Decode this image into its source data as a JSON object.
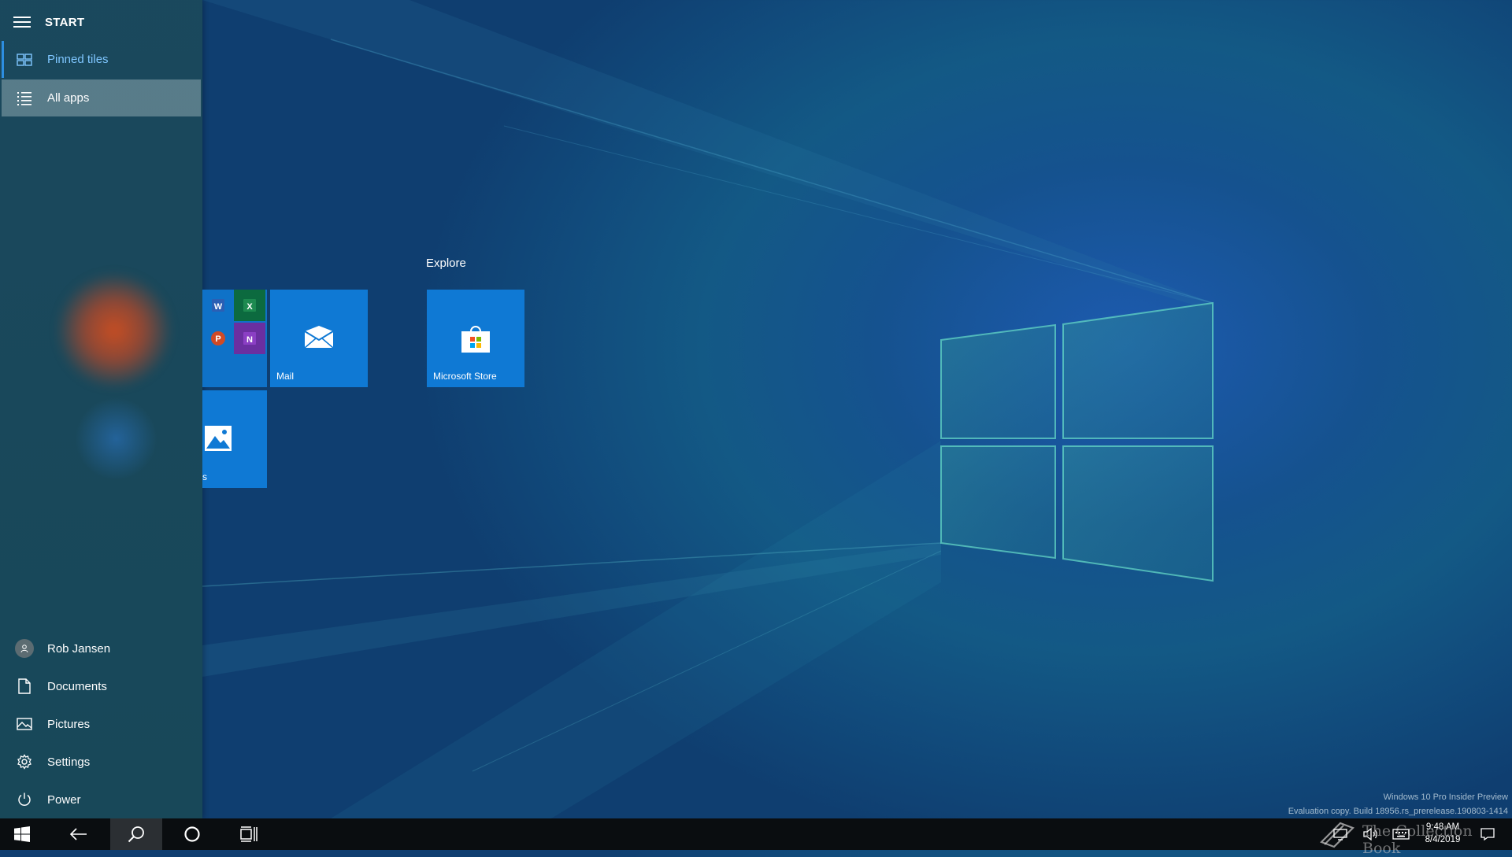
{
  "start": {
    "title": "START",
    "nav": {
      "pinned_tiles": "Pinned tiles",
      "all_apps": "All apps"
    },
    "bottom": {
      "user": "Rob Jansen",
      "documents": "Documents",
      "pictures": "Pictures",
      "settings": "Settings",
      "power": "Power"
    }
  },
  "tiles": {
    "group_explore": "Explore",
    "mail_label": "Mail",
    "store_label": "Microsoft Store",
    "photos_label_fragment": "s",
    "office_apps": [
      "W",
      "X",
      "P",
      "N"
    ]
  },
  "watermark": {
    "line1": "Windows 10 Pro Insider Preview",
    "line2": "Evaluation copy. Build 18956.rs_prerelease.190803-1414"
  },
  "taskbar": {
    "time": "9:48 AM",
    "date": "8/4/2019",
    "overlay_text": "The Collection Book"
  },
  "colors": {
    "tile_blue": "#0f79d4",
    "accent_light": "#7fc6ff",
    "taskbar": "#0a0d10"
  }
}
